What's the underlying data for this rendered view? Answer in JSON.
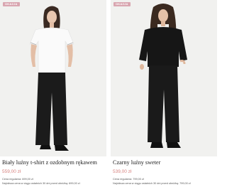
{
  "products": [
    {
      "badge": "OKAZJA",
      "title": "Biały luźny t-shirt z ozdobnym rękawem",
      "price": "559,00 zł",
      "regular_price": "Cena regularna: 699,00 zł",
      "lowest_price": "Najniższa cena w ciągu ostatnich 30 dni przed obniżką: 699,00 zł"
    },
    {
      "badge": "OKAZJA",
      "title": "Czarny luźny sweter",
      "price": "539,00 zł",
      "regular_price": "Cena regularna: 799,00 zł",
      "lowest_price": "Najniższa cena w ciągu ostatnich 30 dni przed obniżką: 799,00 zł"
    }
  ],
  "colors": {
    "badge": "#d9a6b0",
    "price": "#d7827f",
    "photo_background": "#f1f1ef"
  }
}
